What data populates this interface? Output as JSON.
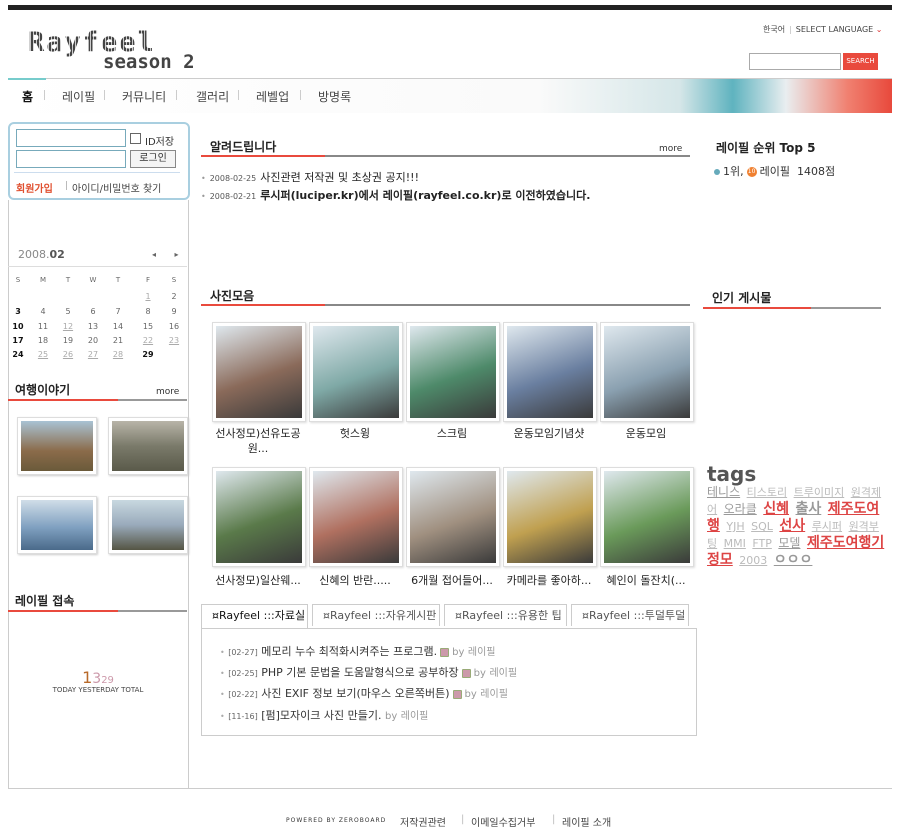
{
  "logo": {
    "main": "Rayfeel",
    "sub": "season 2"
  },
  "lang": {
    "current": "한국어",
    "select": "SELECT LANGUAGE"
  },
  "search": {
    "button": "SEARCH",
    "placeholder": ""
  },
  "nav": [
    "홈",
    "레이필",
    "커뮤니티",
    "갤러리",
    "레벨업",
    "방명록"
  ],
  "login": {
    "remember": "ID저장",
    "button": "로그인",
    "join": "회원가입",
    "find": "아이디/비밀번호 찾기",
    "id_value": "",
    "pw_value": ""
  },
  "calendar": {
    "year": "2008.",
    "month": "02",
    "nav": "◂ ▸",
    "weekdays": [
      "S",
      "M",
      "T",
      "W",
      "T",
      "F",
      "S"
    ],
    "weeks": [
      [
        "",
        "",
        "",
        "",
        "",
        "1",
        "2"
      ],
      [
        "3",
        "4",
        "5",
        "6",
        "7",
        "8",
        "9"
      ],
      [
        "10",
        "11",
        "12",
        "13",
        "14",
        "15",
        "16"
      ],
      [
        "17",
        "18",
        "19",
        "20",
        "21",
        "22",
        "23"
      ],
      [
        "24",
        "25",
        "26",
        "27",
        "28",
        "29",
        ""
      ]
    ]
  },
  "travel": {
    "title": "여행이야기",
    "more": "more"
  },
  "visitors": {
    "title": "레이필 접속",
    "today": "1",
    "yesterday": "3",
    "total": "29",
    "label": "TODAY YESTERDAY TOTAL"
  },
  "notice": {
    "title": "알려드립니다",
    "more": "more",
    "items": [
      {
        "date": "2008-02-25",
        "text": "사진관련 저작권 및 초상권 공지!!!"
      },
      {
        "date": "2008-02-21",
        "text": "루시퍼(luciper.kr)에서 레이필(rayfeel.co.kr)로 이전하였습니다."
      }
    ]
  },
  "photos": {
    "title": "사진모음",
    "items": [
      {
        "caption": "선사정모)선유도공원...",
        "color": "#8a6a5a"
      },
      {
        "caption": "헛스윙",
        "color": "#7fa9a6"
      },
      {
        "caption": "스크림",
        "color": "#4e8a6a"
      },
      {
        "caption": "운동모임기념샷",
        "color": "#6a7fa0"
      },
      {
        "caption": "운동모임",
        "color": "#8aa0b0"
      },
      {
        "caption": "선사정모)일산웨...",
        "color": "#5a7a4a"
      },
      {
        "caption": "신혜의 반란.....",
        "color": "#b07060"
      },
      {
        "caption": "6개월 접어들어...",
        "color": "#a09080"
      },
      {
        "caption": "카메라를 좋아하...",
        "color": "#c0a050"
      },
      {
        "caption": "혜인이 돌잔치(...",
        "color": "#6a9a5a"
      }
    ]
  },
  "tabs": [
    "Rayfeel :::자료실",
    "Rayfeel :::자유게시판",
    "Rayfeel :::유용한 팁",
    "Rayfeel :::투덜투덜"
  ],
  "posts": [
    {
      "date": "[02-27]",
      "title": "메모리 누수 최적화시켜주는 프로그램.",
      "by": "by",
      "author": "레이필",
      "badge": true
    },
    {
      "date": "[02-25]",
      "title": "PHP 기본 문법을 도움말형식으로 공부하장",
      "by": "by",
      "author": "레이필",
      "badge": true
    },
    {
      "date": "[02-22]",
      "title": "사진 EXIF 정보 보기(마우스 오른쪽버튼)",
      "by": "by",
      "author": "레이필",
      "badge": true
    },
    {
      "date": "[11-16]",
      "title": "[펌]모자이크 사진 만들기.",
      "by": "by",
      "author": "레이필",
      "badge": false
    }
  ],
  "ranking": {
    "title": "레이필 순위 Top 5",
    "rank": "1위,",
    "level": "10",
    "name": "레이필",
    "score": "1408점"
  },
  "popular": {
    "title": "인기 게시물"
  },
  "tags": {
    "title": "tags",
    "items": [
      {
        "t": "테니스",
        "c": "m"
      },
      {
        "t": "티스토리",
        "c": ""
      },
      {
        "t": "트루이미지",
        "c": ""
      },
      {
        "t": "원격제어",
        "c": ""
      },
      {
        "t": "오라클",
        "c": "m"
      },
      {
        "t": "신혜",
        "c": "h"
      },
      {
        "t": "출사",
        "c": "dg"
      },
      {
        "t": "제주도여행",
        "c": "h"
      },
      {
        "t": "YJH",
        "c": ""
      },
      {
        "t": "SQL",
        "c": ""
      },
      {
        "t": "선사",
        "c": "h"
      },
      {
        "t": "루시퍼",
        "c": ""
      },
      {
        "t": "원격부팅",
        "c": ""
      },
      {
        "t": "MMI",
        "c": ""
      },
      {
        "t": "FTP",
        "c": ""
      },
      {
        "t": "모델",
        "c": "m"
      },
      {
        "t": "제주도여행기",
        "c": "h"
      },
      {
        "t": "정모",
        "c": "h"
      },
      {
        "t": "2003",
        "c": ""
      },
      {
        "t": "ㅇㅇㅇ",
        "c": "dg"
      }
    ]
  },
  "footer": {
    "powered": "POWERED BY ZEROBOARD",
    "links": [
      "저작권관련",
      "이메일수집거부",
      "레이필 소개"
    ]
  },
  "colors": {
    "accent": "#e94a3d",
    "teal": "#5fb3bf",
    "loginBorder": "#a9cfe0"
  }
}
